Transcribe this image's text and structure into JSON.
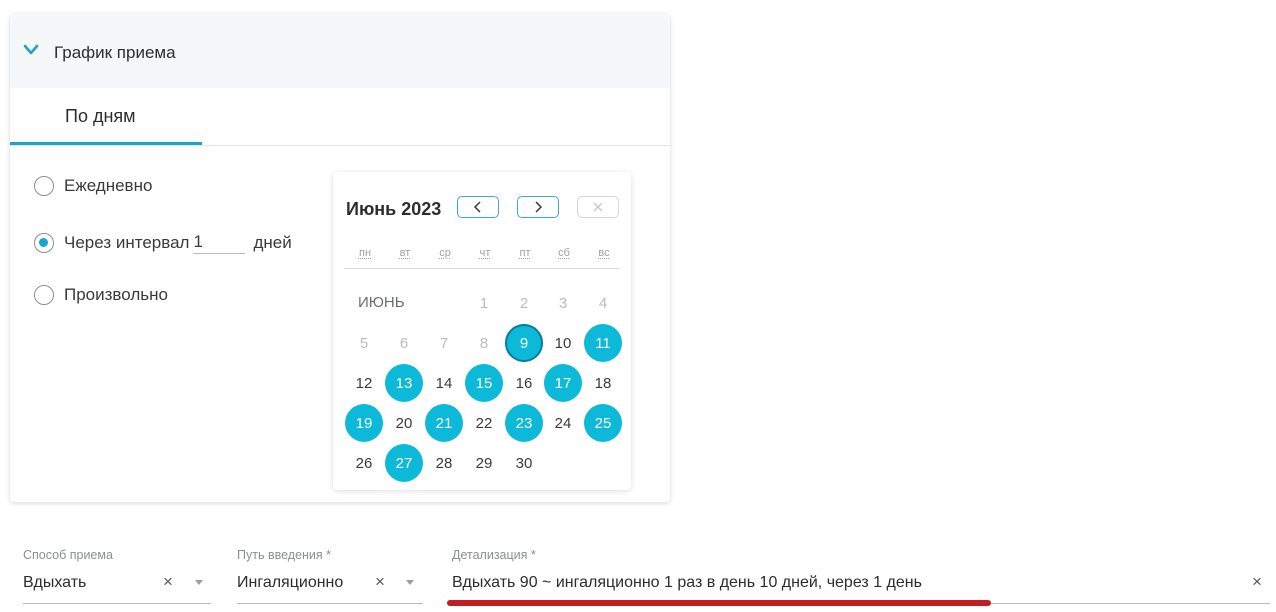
{
  "schedule": {
    "title": "График приема",
    "tab_label": "По дням",
    "options": [
      {
        "label": "Ежедневно",
        "checked": false
      },
      {
        "label": "Через интервал",
        "checked": true,
        "value": "1",
        "suffix": "дней"
      },
      {
        "label": "Произвольно",
        "checked": false
      }
    ]
  },
  "calendar": {
    "title": "Июнь 2023",
    "weekdays": [
      "пн",
      "вт",
      "ср",
      "чт",
      "пт",
      "сб",
      "вс"
    ],
    "month_label": "ИЮНЬ",
    "selected_days": [
      9,
      11,
      13,
      15,
      17,
      19,
      21,
      23,
      25,
      27
    ],
    "today": 9,
    "muted_before": 9
  },
  "fields": {
    "sposob": {
      "label": "Способ приема",
      "value": "Вдыхать",
      "clear": "×"
    },
    "put": {
      "label": "Путь введения *",
      "value": "Ингаляционно",
      "clear": "×"
    },
    "detail": {
      "label": "Детализация *",
      "value": "Вдыхать 90 ~ ингаляционно 1 раз в день 10 дней, через  1 день",
      "clear": "×"
    }
  },
  "colors": {
    "accent": "#1aa5cf",
    "selected_day": "#0db9d8",
    "highlight": "#c41d21"
  }
}
